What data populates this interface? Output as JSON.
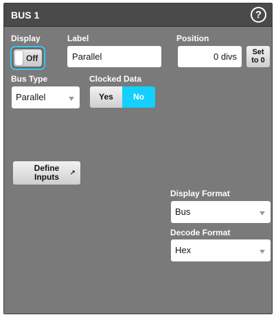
{
  "window": {
    "title": "BUS 1",
    "help_symbol": "?"
  },
  "display": {
    "label": "Display",
    "toggle_value": "Off"
  },
  "label_field": {
    "label": "Label",
    "value": "Parallel"
  },
  "position": {
    "label": "Position",
    "value": "0 divs",
    "set_button_line1": "Set",
    "set_button_line2": "to 0"
  },
  "bus_type": {
    "label": "Bus Type",
    "value": "Parallel"
  },
  "clocked_data": {
    "label": "Clocked Data",
    "yes_label": "Yes",
    "no_label": "No",
    "selected": "No"
  },
  "define_inputs": {
    "line1": "Define",
    "line2": "Inputs"
  },
  "display_format": {
    "label": "Display Format",
    "value": "Bus"
  },
  "decode_format": {
    "label": "Decode Format",
    "value": "Hex"
  },
  "colors": {
    "panel": "#7a7a7a",
    "titlebar": "#4a4a4a",
    "accent": "#12d0ff",
    "focus_ring": "#35c7f0"
  }
}
